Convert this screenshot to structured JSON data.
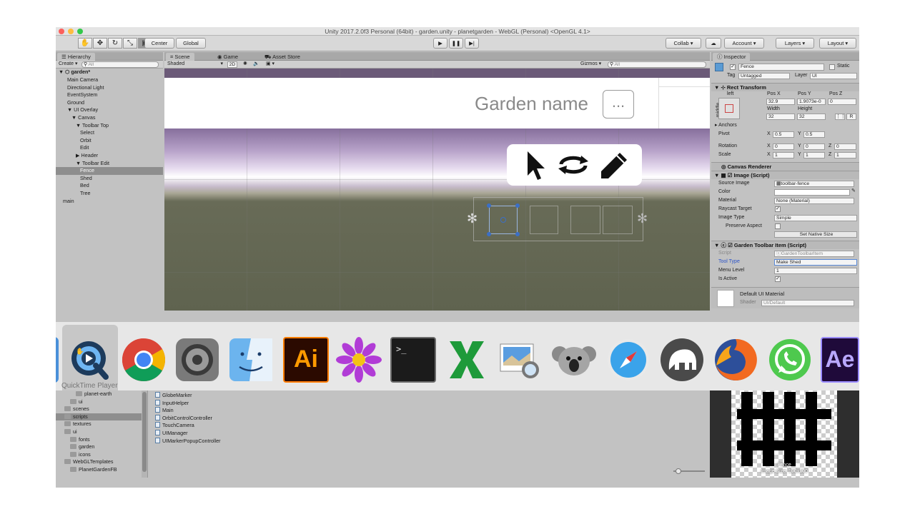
{
  "window": {
    "title": "Unity 2017.2.0f3 Personal (64bit) - garden.unity - planetgarden - WebGL (Personal) <OpenGL 4.1>"
  },
  "toolbar": {
    "pivot_label": "Center",
    "space_label": "Global",
    "collab_label": "Collab",
    "account_label": "Account",
    "layers_label": "Layers",
    "layout_label": "Layout"
  },
  "hierarchy": {
    "tab_label": "Hierarchy",
    "create_label": "Create",
    "search_placeholder": "All",
    "scene_name": "garden*",
    "items": [
      {
        "label": "Main Camera",
        "indent": 1
      },
      {
        "label": "Directional Light",
        "indent": 1
      },
      {
        "label": "EventSystem",
        "indent": 1
      },
      {
        "label": "Ground",
        "indent": 1
      },
      {
        "label": "UI Overlay",
        "indent": 1
      },
      {
        "label": "Canvas",
        "indent": 2
      },
      {
        "label": "Toolbar Top",
        "indent": 3
      },
      {
        "label": "Select",
        "indent": 4
      },
      {
        "label": "Orbit",
        "indent": 4
      },
      {
        "label": "Edit",
        "indent": 4
      },
      {
        "label": "Header",
        "indent": 3
      },
      {
        "label": "Toolbar Edit",
        "indent": 3
      },
      {
        "label": "Fence",
        "indent": 4
      },
      {
        "label": "Shed",
        "indent": 4
      },
      {
        "label": "Bed",
        "indent": 4
      },
      {
        "label": "Tree",
        "indent": 4
      },
      {
        "label": "main",
        "indent": 0
      }
    ],
    "selected_index": 12
  },
  "scene_view": {
    "tabs": [
      "Scene",
      "Game",
      "Asset Store"
    ],
    "shading_mode": "Shaded",
    "mode_2d": "2D",
    "gizmos_label": "Gizmos",
    "search_placeholder": "All",
    "garden_name_text": "Garden name",
    "ellipsis_button": "...",
    "tool_icons": [
      "cursor-icon",
      "orbit-icon",
      "pencil-icon"
    ]
  },
  "inspector": {
    "tab_label": "Inspector",
    "object_name": "Fence",
    "static_label": "Static",
    "tag_label": "Tag",
    "tag_value": "Untagged",
    "layer_label": "Layer",
    "layer_value": "UI",
    "rect_transform": {
      "title": "Rect Transform",
      "anchor_h": "left",
      "anchor_v": "middle",
      "pos_x_label": "Pos X",
      "pos_y_label": "Pos Y",
      "pos_z_label": "Pos Z",
      "pos_x": "32.9",
      "pos_y": "1.9073e-0",
      "pos_z": "0",
      "width_label": "Width",
      "height_label": "Height",
      "width": "32",
      "height": "32",
      "r_button": "R",
      "anchors_label": "Anchors",
      "pivot_label": "Pivot",
      "pivot_x": "0.5",
      "pivot_y": "0.5",
      "rotation_label": "Rotation",
      "rot_x": "0",
      "rot_y": "0",
      "rot_z": "0",
      "scale_label": "Scale",
      "scale_x": "1",
      "scale_y": "1",
      "scale_z": "1"
    },
    "canvas_renderer": "Canvas Renderer",
    "image": {
      "title": "Image (Script)",
      "source_image_label": "Source Image",
      "source_image": "toolbar-fence",
      "color_label": "Color",
      "material_label": "Material",
      "material": "None (Material)",
      "raycast_label": "Raycast Target",
      "image_type_label": "Image Type",
      "image_type": "Simple",
      "preserve_label": "Preserve Aspect",
      "native_size_button": "Set Native Size"
    },
    "toolbar_item": {
      "title": "Garden Toolbar Item (Script)",
      "script_label": "Script",
      "script": "GardenToolbarItem",
      "tool_type_label": "Tool Type",
      "tool_type": "Make Shed",
      "menu_level_label": "Menu Level",
      "menu_level": "1",
      "is_active_label": "Is Active"
    },
    "material": {
      "title": "Default UI Material",
      "shader_label": "Shader",
      "shader": "UI/Default"
    }
  },
  "dock": {
    "hover_label": "QuickTime Player",
    "apps": [
      "quicktime-icon",
      "chrome-icon",
      "system-preferences-icon",
      "finder-icon",
      "illustrator-icon",
      "flower-app-icon",
      "terminal-icon",
      "excel-icon",
      "preview-icon",
      "koala-icon",
      "safari-icon",
      "mamp-icon",
      "firefox-icon",
      "whatsapp-icon",
      "after-effects-icon"
    ],
    "ai_text": "Ai",
    "ae_text": "Ae",
    "terminal_text": ">_"
  },
  "project": {
    "folders": [
      {
        "label": "planet-earth",
        "indent": 2
      },
      {
        "label": "ui",
        "indent": 1
      },
      {
        "label": "scenes",
        "indent": 0
      },
      {
        "label": "scripts",
        "indent": 0
      },
      {
        "label": "textures",
        "indent": 0
      },
      {
        "label": "ui",
        "indent": 0
      },
      {
        "label": "fonts",
        "indent": 1
      },
      {
        "label": "garden",
        "indent": 1
      },
      {
        "label": "icons",
        "indent": 1
      },
      {
        "label": "WebGLTemplates",
        "indent": 0
      },
      {
        "label": "PlanetGardenFB",
        "indent": 1
      }
    ],
    "scripts": [
      "GlobeMarker",
      "InputHelper",
      "Main",
      "OrbitControlController",
      "TouchCamera",
      "UIManager",
      "UIMarkerPopupController"
    ]
  },
  "preview": {
    "name": "Fence",
    "size_text": "Image Size: 100x100"
  }
}
